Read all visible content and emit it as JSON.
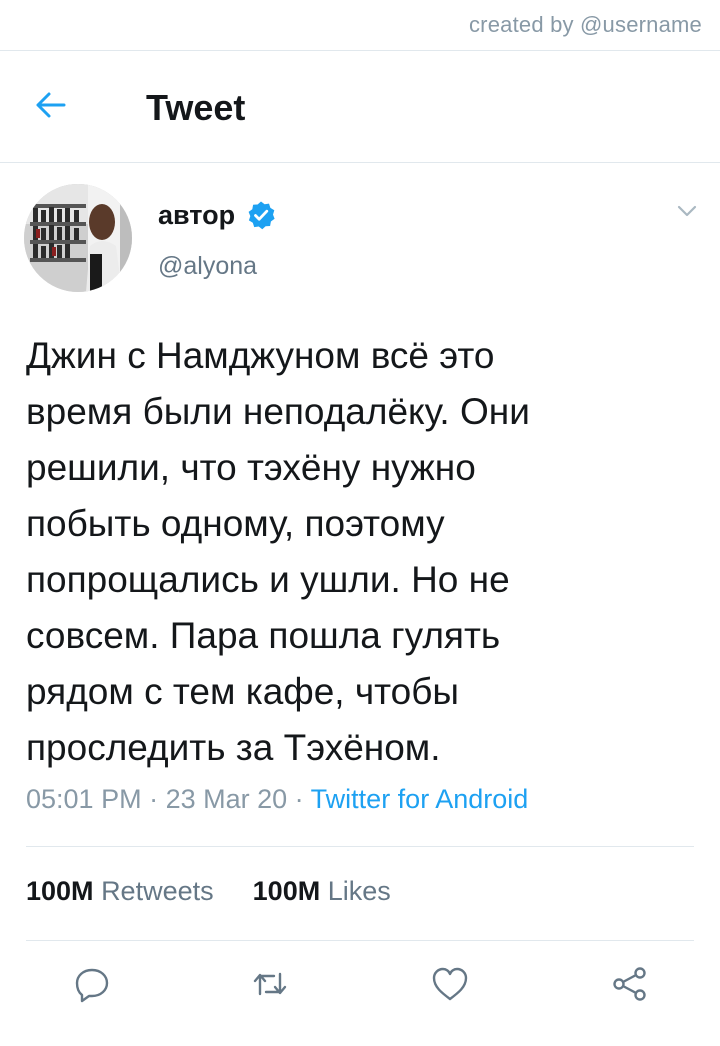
{
  "credit": "created by @username",
  "header": {
    "title": "Tweet",
    "back_icon": "arrow-left-icon",
    "accent": "#1da1f2"
  },
  "author": {
    "name": "автор",
    "verified": true,
    "handle": "@alyona"
  },
  "tweet": {
    "lines": "Джин с Намджуном всё это\nвремя были неподалёку. Они\nрешили, что тэхёну нужно\nпобыть одному, поэтому\nпопрощались и ушли. Но не\nсовсем. Пара пошла гулять\nрядом с тем кафе, чтобы\nпроследить за Тэхёном."
  },
  "meta": {
    "time": "05:01 PM",
    "sep1": " · ",
    "date": "23 Mar 20",
    "sep2": " · ",
    "source": "Twitter for Android"
  },
  "stats": {
    "retweets_count": "100M",
    "retweets_label": "Retweets",
    "likes_count": "100M",
    "likes_label": "Likes"
  },
  "actions": [
    "reply-icon",
    "retweet-icon",
    "like-icon",
    "share-icon"
  ],
  "colors": {
    "text": "#14171a",
    "secondary": "#657786",
    "muted": "#8899a6",
    "divider": "#e1e8ed",
    "link": "#1da1f2"
  }
}
